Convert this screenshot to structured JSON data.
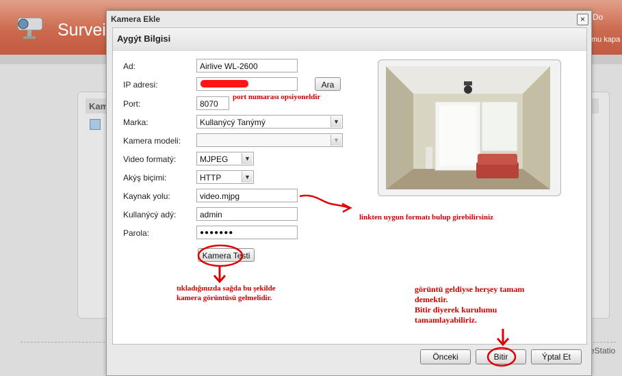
{
  "app": {
    "title": "Surveil",
    "topright": "Do",
    "topright2": "mu kapa",
    "panel_title": "Kam",
    "footer_text": "eStatio"
  },
  "dialog": {
    "title": "Kamera Ekle",
    "close_label": "×",
    "section_title": "Aygýt Bilgisi",
    "fields": {
      "name": {
        "label": "Ad:",
        "value": "Airlive WL-2600"
      },
      "ip": {
        "label": "IP adresi:",
        "value": ""
      },
      "port": {
        "label": "Port:",
        "value": "8070"
      },
      "brand": {
        "label": "Marka:",
        "value": "Kullanýcý Tanýmý"
      },
      "model": {
        "label": "Kamera modeli:",
        "value": ""
      },
      "video_format": {
        "label": "Video formatý:",
        "value": "MJPEG"
      },
      "stream_type": {
        "label": "Akýş biçimi:",
        "value": "HTTP"
      },
      "source_path": {
        "label": "Kaynak yolu:",
        "value": "video.mjpg"
      },
      "username": {
        "label": "Kullanýcý adý:",
        "value": "admin"
      },
      "password": {
        "label": "Parola:",
        "value": "●●●●●●●"
      }
    },
    "search_button": "Ara",
    "test_button": "Kamera Testi",
    "footer": {
      "prev": "Önceki",
      "finish": "Bitir",
      "cancel": "Ýptal Et"
    }
  },
  "annotations": {
    "port": "port numarası opsiyoneldir",
    "link": "linkten uygun formatı bulup girebilirsiniz",
    "test_line1": "tıkladığınızda sağda bu şekilde",
    "test_line2": "kamera görüntüsü gelmelidir.",
    "finish_line1": "görüntü geldiyse herşey tamam",
    "finish_line2": "demektir.",
    "finish_line3": "Bitir diyerek kurulumu",
    "finish_line4": "tamamlayabiliriz."
  },
  "colors": {
    "header": "#cc6a4e",
    "annotation_red": "#d40000",
    "dialog_bg": "#e9e9e9"
  }
}
